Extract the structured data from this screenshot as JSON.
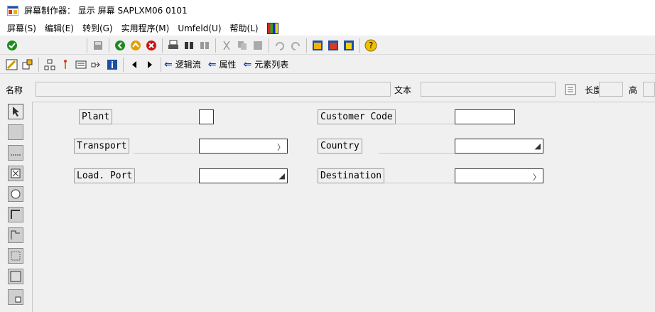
{
  "window": {
    "title": "屏幕制作器： 显示 屏幕 SAPLXM06 0101"
  },
  "menu": [
    {
      "label": "屏幕(S)"
    },
    {
      "label": "编辑(E)"
    },
    {
      "label": "转到(G)"
    },
    {
      "label": "实用程序(M)"
    },
    {
      "label": "Umfeld(U)"
    },
    {
      "label": "帮助(L)"
    }
  ],
  "toolbar2": {
    "logic_flow": "逻辑流",
    "attributes": "属性",
    "element_list": "元素列表"
  },
  "namebar": {
    "name_label": "名称",
    "text_label": "文本",
    "length_label": "长度",
    "height_label": "高"
  },
  "fields": {
    "plant": "Plant",
    "transport": "Transport",
    "load_port": "Load. Port",
    "customer_code": "Customer Code",
    "country": "Country",
    "destination": "Destination"
  },
  "icons": {
    "colors": {
      "green_check": "#1e8a1e",
      "red_cancel": "#c81414",
      "yellow_help": "#f0c000",
      "blue_arrow": "#1045b8"
    }
  }
}
